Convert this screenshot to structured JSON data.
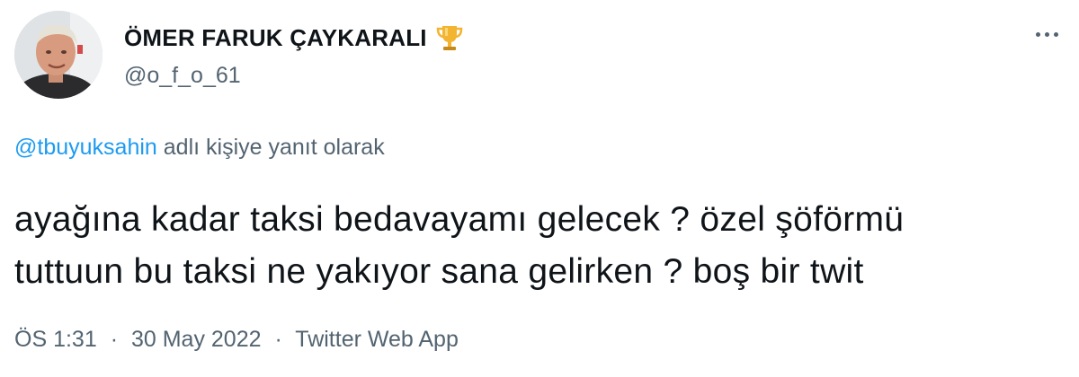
{
  "user": {
    "display_name": "ÖMER FARUK ÇAYKARALI",
    "handle": "@o_f_o_61",
    "badge_icon": "trophy-icon"
  },
  "menu": {
    "icon": "more-options-icon"
  },
  "reply": {
    "mention": "@tbuyuksahin",
    "suffix": "adlı kişiye yanıt olarak"
  },
  "tweet": {
    "lines": [
      "ayağına kadar taksi bedavayamı gelecek ? özel şöförmü",
      "tuttuun bu taksi ne yakıyor sana gelirken ? boş bir twit"
    ]
  },
  "meta": {
    "time": "ÖS 1:31",
    "date": "30 May 2022",
    "source": "Twitter Web App",
    "separator": "·"
  },
  "colors": {
    "text": "#0f1419",
    "secondary": "#536471",
    "link": "#1d9bf0"
  }
}
